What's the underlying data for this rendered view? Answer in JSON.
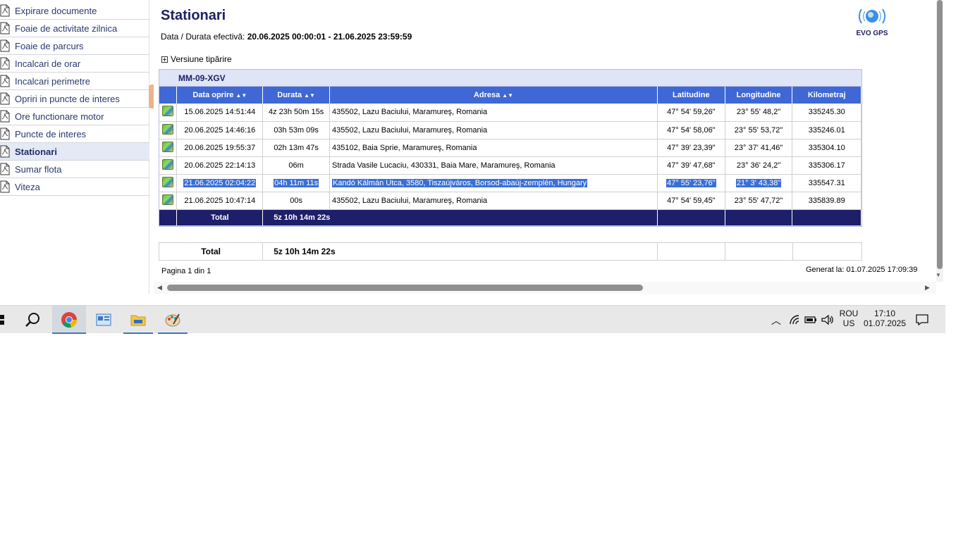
{
  "sidebar": {
    "items": [
      {
        "label": "Expirare documente",
        "active": false
      },
      {
        "label": "Foaie de activitate zilnica",
        "active": false
      },
      {
        "label": "Foaie de parcurs",
        "active": false
      },
      {
        "label": "Incalcari de orar",
        "active": false
      },
      {
        "label": "Incalcari perimetre",
        "active": false
      },
      {
        "label": "Opriri in puncte de interes",
        "active": false
      },
      {
        "label": "Ore functionare motor",
        "active": false
      },
      {
        "label": "Puncte de interes",
        "active": false
      },
      {
        "label": "Stationari",
        "active": true
      },
      {
        "label": "Sumar flota",
        "active": false
      },
      {
        "label": "Viteza",
        "active": false
      }
    ]
  },
  "report": {
    "title": "Stationari",
    "period_label": "Data / Durata efectivă:",
    "period_value": "20.06.2025 00:00:01 - 21.06.2025 23:59:59",
    "logo_text": "EVO GPS",
    "print_toggle": "Versiune tipărire",
    "vehicle": "MM-09-XGV",
    "columns": [
      "Data oprire",
      "Durata",
      "Adresa",
      "Latitudine",
      "Longitudine",
      "Kilometraj"
    ],
    "rows": [
      {
        "date": "15.06.2025 14:51:44",
        "duration": "4z 23h 50m 15s",
        "address": "435502, Lazu Baciului, Maramureş, Romania",
        "lat": "47° 54' 59,26\"",
        "lon": "23° 55' 48,2\"",
        "km": "335245.30",
        "highlight": false
      },
      {
        "date": "20.06.2025 14:46:16",
        "duration": "03h 53m 09s",
        "address": "435502, Lazu Baciului, Maramureş, Romania",
        "lat": "47° 54' 58,06\"",
        "lon": "23° 55' 53,72\"",
        "km": "335246.01",
        "highlight": false
      },
      {
        "date": "20.06.2025 19:55:37",
        "duration": "02h 13m 47s",
        "address": "435102, Baia Sprie, Maramureş, Romania",
        "lat": "47° 39' 23,39\"",
        "lon": "23° 37' 41,46\"",
        "km": "335304.10",
        "highlight": false
      },
      {
        "date": "20.06.2025 22:14:13",
        "duration": "06m",
        "address": "Strada Vasile Lucaciu,  430331, Baia Mare, Maramureş, Romania",
        "lat": "47° 39' 47,68\"",
        "lon": "23° 36' 24,2\"",
        "km": "335306.17",
        "highlight": false
      },
      {
        "date": "21.06.2025 02:04:22",
        "duration": "04h 11m 11s",
        "address": "Kandó Kálmán Utca,  3580, Tiszaújváros, Borsod-abaúj-zemplén, Hungary",
        "lat": "47° 55' 23,76\"",
        "lon": "21° 3' 43,38\"",
        "km": "335547.31",
        "highlight": true
      },
      {
        "date": "21.06.2025 10:47:14",
        "duration": "00s",
        "address": "435502, Lazu Baciului, Maramureş, Romania",
        "lat": "47° 54' 59,45\"",
        "lon": "23° 55' 47,72\"",
        "km": "335839.89",
        "highlight": false
      }
    ],
    "total_label": "Total",
    "total_value": "5z 10h 14m 22s",
    "grand_total_label": "Total",
    "grand_total_value": "5z 10h 14m 22s",
    "page_info": "Pagina 1 din 1",
    "generated": "Generat la: 01.07.2025 17:09:39"
  },
  "taskbar": {
    "apps": [
      "start-icon",
      "search-icon",
      "chrome-icon",
      "control-panel-icon",
      "file-explorer-icon",
      "paint-icon"
    ],
    "lang_top": "ROU",
    "lang_bottom": "US",
    "time": "17:10",
    "date": "01.07.2025"
  },
  "colors": {
    "header_blue": "#3f68d6",
    "navy": "#1d1f6a",
    "title": "#1d2164",
    "highlight": "#3a6fd8"
  }
}
